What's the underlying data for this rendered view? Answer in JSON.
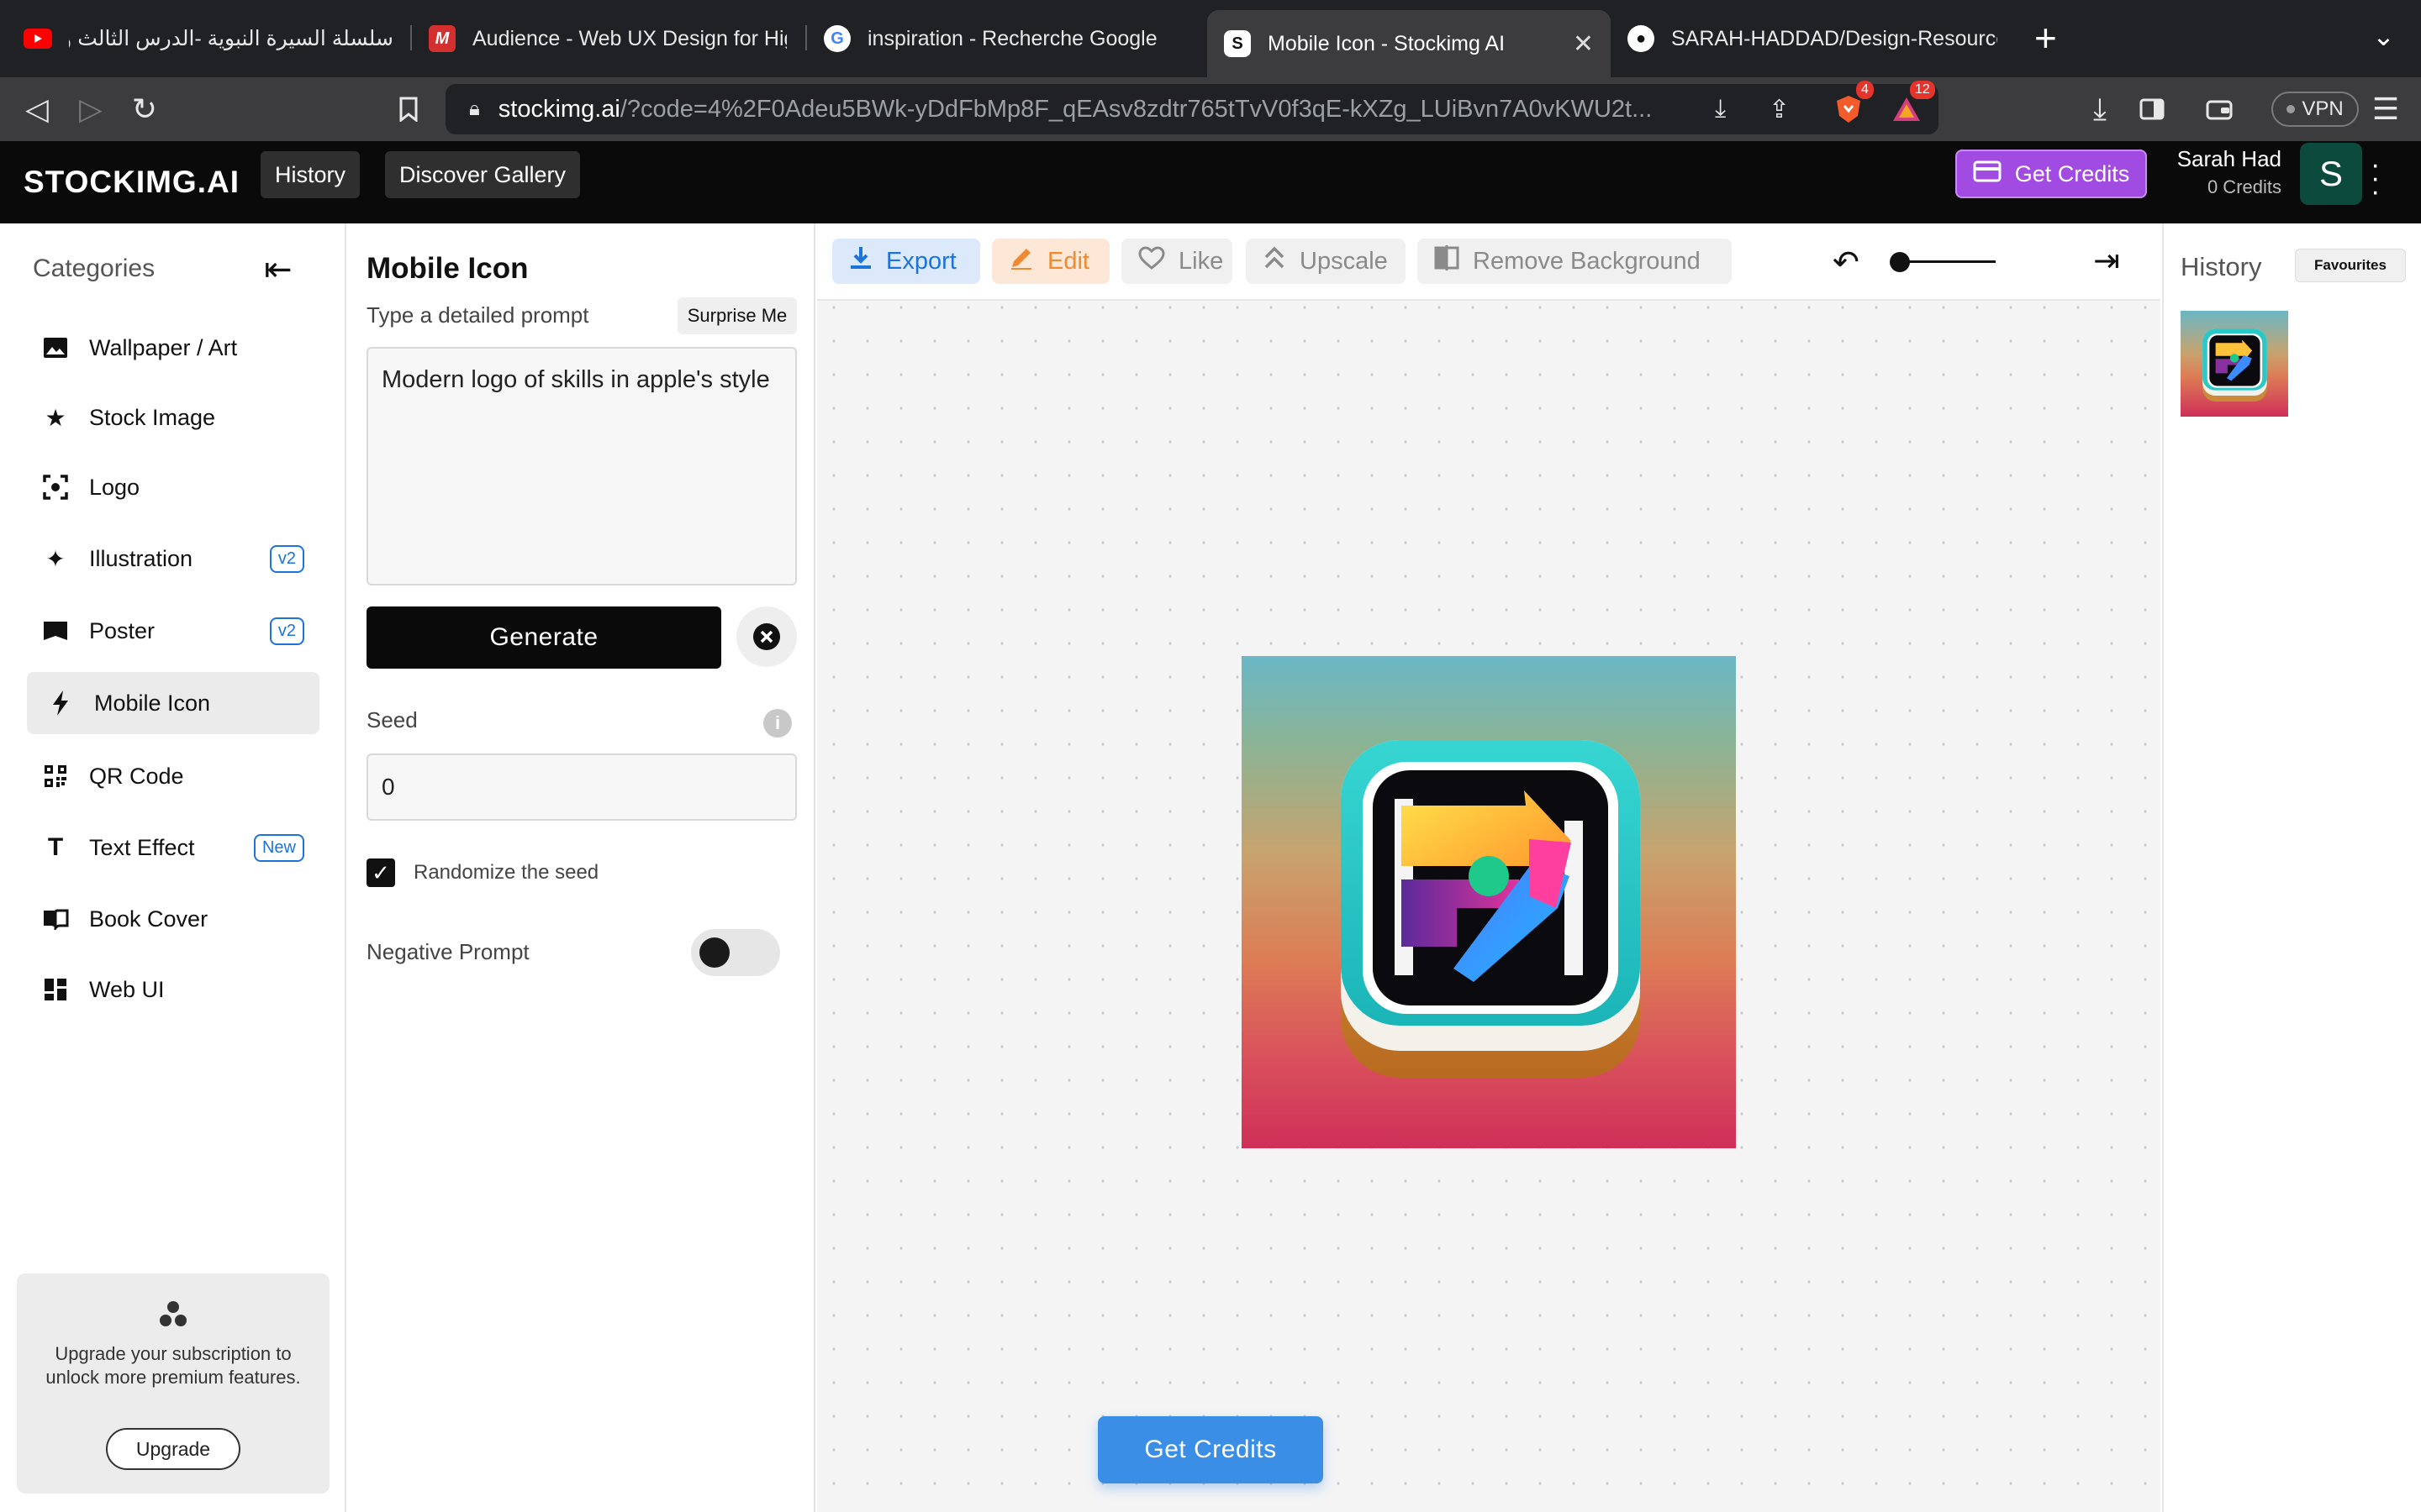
{
  "browser": {
    "tabs": [
      {
        "title": "سلسلة السيرة النبوية -الدرس الثالث والعش",
        "icon": "youtube-icon"
      },
      {
        "title": "Audience - Web UX Design for High",
        "icon": "m-logo-icon"
      },
      {
        "title": "inspiration - Recherche Google",
        "icon": "google-icon"
      },
      {
        "title": "Mobile Icon - Stockimg AI",
        "icon": "stockimg-icon",
        "active": true
      },
      {
        "title": "SARAH-HADDAD/Design-Resources",
        "icon": "github-icon"
      }
    ],
    "url_domain": "stockimg.ai",
    "url_rest": "/?code=4%2F0Adeu5BWk-yDdFbMp8F_qEAsv8zdtr765tTvV0f3qE-kXZg_LUiBvn7A0vKWU2t...",
    "brave_count": "4",
    "alert_count": "12",
    "vpn_label": "VPN"
  },
  "app": {
    "logo": "STOCKIMG.AI",
    "nav": {
      "history": "History",
      "discover": "Discover Gallery"
    },
    "get_credits": "Get Credits",
    "user": {
      "name": "Sarah Had",
      "credits": "0 Credits",
      "initial": "S"
    }
  },
  "sidebar": {
    "title": "Categories",
    "items": [
      {
        "label": "Wallpaper / Art",
        "icon": "image-icon"
      },
      {
        "label": "Stock Image",
        "icon": "star-icon"
      },
      {
        "label": "Logo",
        "icon": "focus-icon"
      },
      {
        "label": "Illustration",
        "icon": "sparkle-icon",
        "tag": "v2"
      },
      {
        "label": "Poster",
        "icon": "flag-icon",
        "tag": "v2"
      },
      {
        "label": "Mobile Icon",
        "icon": "bolt-icon",
        "active": true
      },
      {
        "label": "QR Code",
        "icon": "qr-icon"
      },
      {
        "label": "Text Effect",
        "icon": "text-icon",
        "tag": "New"
      },
      {
        "label": "Book Cover",
        "icon": "book-icon"
      },
      {
        "label": "Web UI",
        "icon": "dashboard-icon"
      }
    ],
    "upgrade": {
      "text": "Upgrade your subscription to unlock more premium features.",
      "button": "Upgrade"
    }
  },
  "panel": {
    "title": "Mobile Icon",
    "subtitle": "Type a detailed prompt",
    "surprise": "Surprise Me",
    "prompt_value": "Modern logo of skills in apple's style",
    "generate": "Generate",
    "seed_label": "Seed",
    "seed_value": "0",
    "randomize_label": "Randomize the seed",
    "randomize_checked": true,
    "negative_label": "Negative Prompt",
    "negative_enabled": false
  },
  "toolbar": {
    "export": "Export",
    "edit": "Edit",
    "like": "Like",
    "upscale": "Upscale",
    "remove_bg": "Remove Background"
  },
  "canvas": {
    "get_credits": "Get Credits"
  },
  "history": {
    "title": "History",
    "favourites": "Favourites"
  },
  "colors": {
    "accent_purple": "#a24be2",
    "accent_blue": "#3a8ee6",
    "export_blue": "#1e73d8",
    "edit_orange": "#f08a30"
  }
}
